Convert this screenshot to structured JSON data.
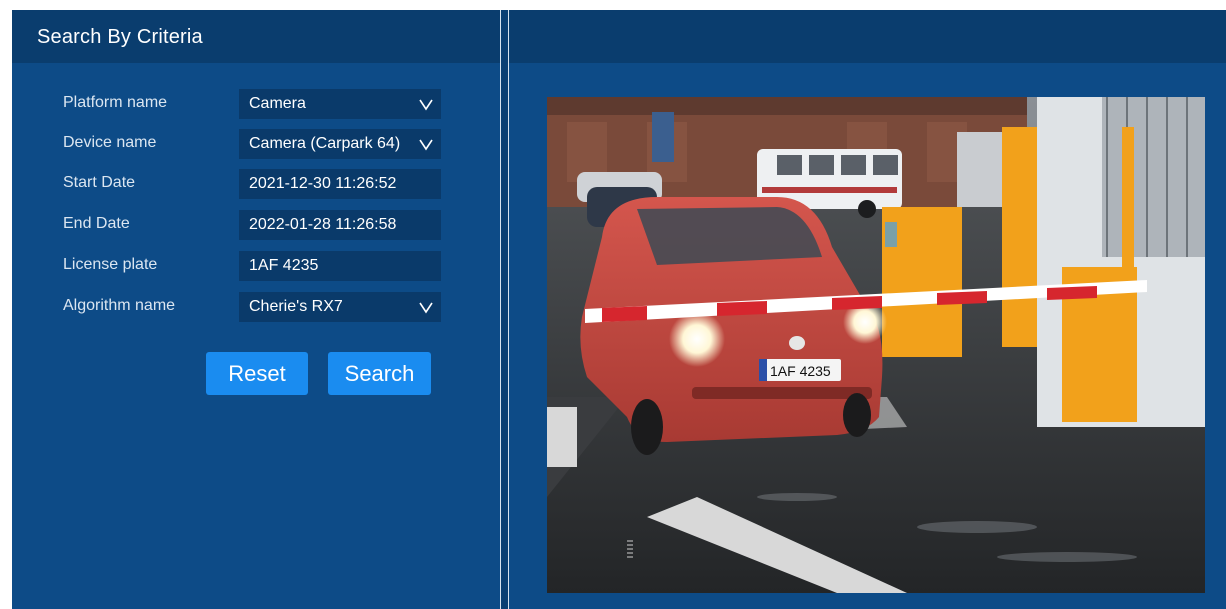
{
  "search_panel": {
    "title": "Search By Criteria",
    "fields": [
      {
        "label": "Platform name",
        "value": "Camera",
        "type": "select",
        "icon": "chevron-down-icon"
      },
      {
        "label": "Device name",
        "value": "Camera (Carpark 64)",
        "type": "select",
        "icon": "chevron-down-icon"
      },
      {
        "label": "Start Date",
        "value": "2021-12-30 11:26:52",
        "type": "datetime"
      },
      {
        "label": "End Date",
        "value": "2022-01-28 11:26:58",
        "type": "datetime"
      },
      {
        "label": "License plate",
        "value": "1AF 4235",
        "type": "text"
      },
      {
        "label": "Algorithm name",
        "value": "Cherie's RX7",
        "type": "select",
        "icon": "chevron-down-icon"
      }
    ],
    "reset_label": "Reset",
    "search_label": "Search"
  },
  "camera_view": {
    "plate_text": "1AF 4235"
  },
  "colors": {
    "panel_bg": "#0d4b87",
    "header_bg": "#0a3d6e",
    "field_bg": "#0a3a6a",
    "button_bg": "#1a8cf0"
  }
}
